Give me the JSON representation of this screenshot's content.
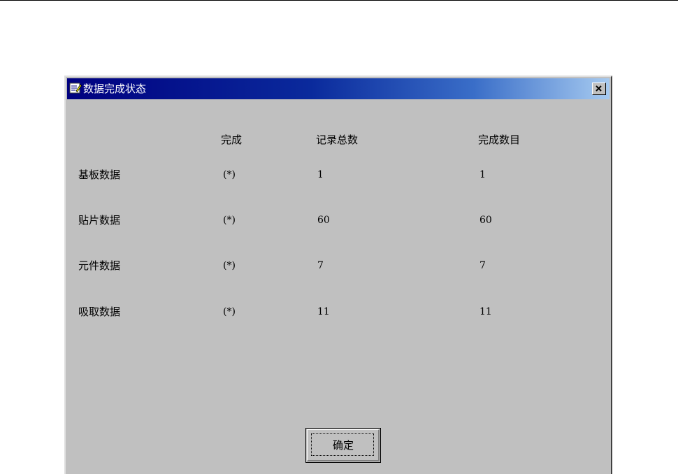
{
  "window": {
    "title": "数据完成状态",
    "icon": "edit-window-icon",
    "close_icon": "close-icon"
  },
  "headers": [
    "完成",
    "记录总数",
    "完成数目"
  ],
  "rows": [
    {
      "label": "基板数据",
      "done": "(*)",
      "total": "1",
      "completed": "1"
    },
    {
      "label": "贴片数据",
      "done": "(*)",
      "total": "60",
      "completed": "60"
    },
    {
      "label": "元件数据",
      "done": "(*)",
      "total": "7",
      "completed": "7"
    },
    {
      "label": "吸取数据",
      "done": "(*)",
      "total": "11",
      "completed": "11"
    }
  ],
  "buttons": {
    "ok": "确定"
  },
  "colors": {
    "dialog_bg": "#c0c0c0",
    "title_start": "#000080",
    "title_end": "#a6caf0",
    "title_text": "#ffffff"
  }
}
